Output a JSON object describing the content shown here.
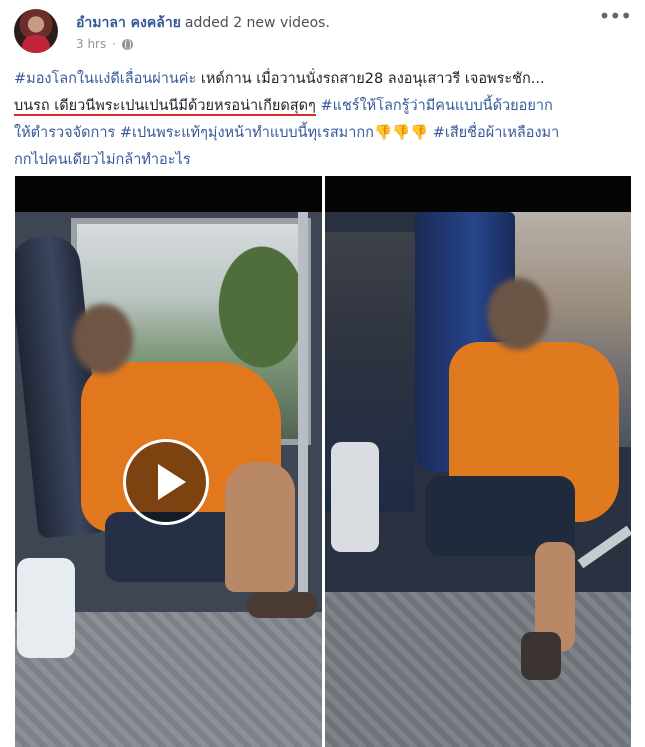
{
  "post": {
    "author": "อำมาลา คงคล้าย",
    "action": "added 2 new videos.",
    "time": "3 hrs",
    "separator": "·",
    "more_icon": "ellipsis-icon",
    "privacy_icon": "globe-icon"
  },
  "caption": {
    "tag1": "#มองโลกในแง่ดีเลื่อนผ่านค่ะ",
    "text1": " เหด์กาน เมื่อวานนั่งรถสาย28 ลงอนุเสาวรี เจอพระชัก...",
    "highlight": "บนรถ เดียวนีพระเปนเปนนีมีด้วยหรอน่าเกียดสุดๆ",
    "space1": " ",
    "tag2": "#แชร์ให้โลกรู้ว่ามีคนแบบนี้ด้วยอยาก",
    "tag2b": "ให้ตำรวจจัดการ",
    "space2": " ",
    "tag3": "#เปนพระแท้ๆมุ่งหน้าทำแบบนี้ทุเรสมากก",
    "emoji": "👎👎👎",
    "space3": " ",
    "tag4": "#เสียชื่อผ้าเหลืองมา",
    "tag4b": "กกไปคนเดียวไม่กล้าทำอะไร"
  },
  "videos": {
    "count": 2,
    "play_icon": "play-icon"
  },
  "colors": {
    "link": "#365899",
    "highlight_underline": "#e0282c",
    "meta": "#90949c"
  }
}
